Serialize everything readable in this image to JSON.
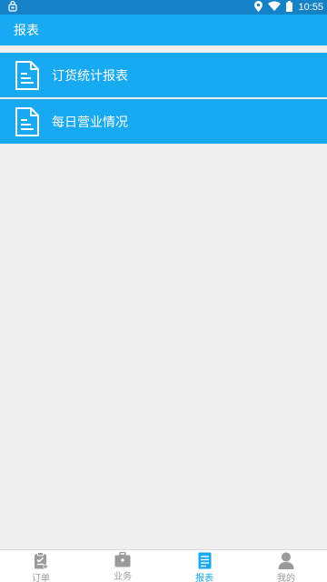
{
  "status_bar": {
    "time": "10:55",
    "left_icon": "notification-icon",
    "right_icons": [
      "location-icon",
      "wifi-icon",
      "battery-icon"
    ]
  },
  "app_bar": {
    "title": "报表"
  },
  "reports": {
    "items": [
      {
        "label": "订货统计报表",
        "icon": "document-icon"
      },
      {
        "label": "每日营业情况",
        "icon": "document-icon"
      }
    ]
  },
  "bottom_nav": {
    "items": [
      {
        "label": "订单",
        "icon": "clipboard-icon",
        "active": false
      },
      {
        "label": "业务",
        "icon": "briefcase-icon",
        "active": false
      },
      {
        "label": "报表",
        "icon": "report-icon",
        "active": true
      },
      {
        "label": "我的",
        "icon": "user-icon",
        "active": false
      }
    ]
  },
  "colors": {
    "primary": "#17a9f1",
    "status_bar": "#1482c4",
    "background": "#efefef",
    "nav_inactive": "#9a9a9a"
  }
}
